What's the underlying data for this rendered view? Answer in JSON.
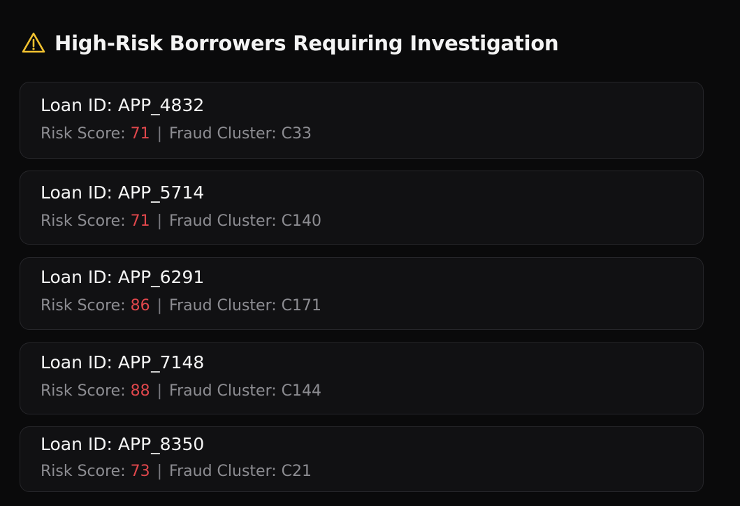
{
  "header": {
    "title": "High-Risk Borrowers Requiring Investigation",
    "icon": "warning-triangle-icon",
    "icon_color": "#f2c230"
  },
  "labels": {
    "loan_id_prefix": "Loan ID: ",
    "risk_score_prefix": "Risk Score: ",
    "separator": "|",
    "fraud_cluster_prefix": "Fraud Cluster: "
  },
  "colors": {
    "score": "#e0474c",
    "muted_text": "#8d8d92",
    "card_bg": "#111113",
    "page_bg": "#0a0a0b"
  },
  "borrowers": [
    {
      "loan_id": "APP_4832",
      "risk_score": "71",
      "fraud_cluster": "C33"
    },
    {
      "loan_id": "APP_5714",
      "risk_score": "71",
      "fraud_cluster": "C140"
    },
    {
      "loan_id": "APP_6291",
      "risk_score": "86",
      "fraud_cluster": "C171"
    },
    {
      "loan_id": "APP_7148",
      "risk_score": "88",
      "fraud_cluster": "C144"
    },
    {
      "loan_id": "APP_8350",
      "risk_score": "73",
      "fraud_cluster": "C21"
    }
  ]
}
